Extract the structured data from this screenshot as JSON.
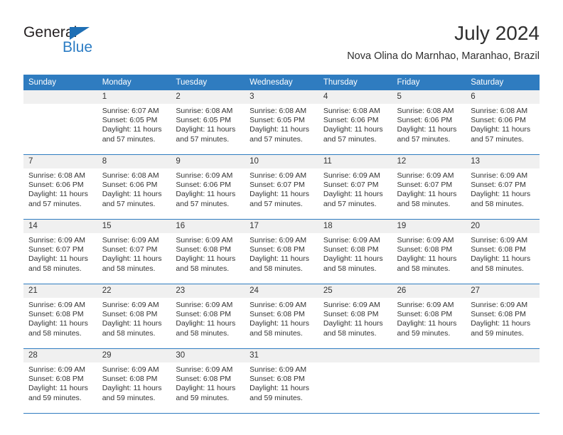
{
  "brand": {
    "name_part1": "General",
    "name_part2": "Blue",
    "accent_color": "#2b7cc4",
    "triangle_color": "#1f6fb5"
  },
  "header": {
    "title": "July 2024",
    "subtitle": "Nova Olina do Marnhao, Maranhao, Brazil"
  },
  "calendar": {
    "header_bg": "#2f7cc0",
    "daynum_bg": "#f0f0f0",
    "weekday_headers": [
      "Sunday",
      "Monday",
      "Tuesday",
      "Wednesday",
      "Thursday",
      "Friday",
      "Saturday"
    ],
    "weeks": [
      [
        {
          "day": "",
          "sunrise": "",
          "sunset": "",
          "daylight1": "",
          "daylight2": ""
        },
        {
          "day": "1",
          "sunrise": "Sunrise: 6:07 AM",
          "sunset": "Sunset: 6:05 PM",
          "daylight1": "Daylight: 11 hours",
          "daylight2": "and 57 minutes."
        },
        {
          "day": "2",
          "sunrise": "Sunrise: 6:08 AM",
          "sunset": "Sunset: 6:05 PM",
          "daylight1": "Daylight: 11 hours",
          "daylight2": "and 57 minutes."
        },
        {
          "day": "3",
          "sunrise": "Sunrise: 6:08 AM",
          "sunset": "Sunset: 6:05 PM",
          "daylight1": "Daylight: 11 hours",
          "daylight2": "and 57 minutes."
        },
        {
          "day": "4",
          "sunrise": "Sunrise: 6:08 AM",
          "sunset": "Sunset: 6:06 PM",
          "daylight1": "Daylight: 11 hours",
          "daylight2": "and 57 minutes."
        },
        {
          "day": "5",
          "sunrise": "Sunrise: 6:08 AM",
          "sunset": "Sunset: 6:06 PM",
          "daylight1": "Daylight: 11 hours",
          "daylight2": "and 57 minutes."
        },
        {
          "day": "6",
          "sunrise": "Sunrise: 6:08 AM",
          "sunset": "Sunset: 6:06 PM",
          "daylight1": "Daylight: 11 hours",
          "daylight2": "and 57 minutes."
        }
      ],
      [
        {
          "day": "7",
          "sunrise": "Sunrise: 6:08 AM",
          "sunset": "Sunset: 6:06 PM",
          "daylight1": "Daylight: 11 hours",
          "daylight2": "and 57 minutes."
        },
        {
          "day": "8",
          "sunrise": "Sunrise: 6:08 AM",
          "sunset": "Sunset: 6:06 PM",
          "daylight1": "Daylight: 11 hours",
          "daylight2": "and 57 minutes."
        },
        {
          "day": "9",
          "sunrise": "Sunrise: 6:09 AM",
          "sunset": "Sunset: 6:06 PM",
          "daylight1": "Daylight: 11 hours",
          "daylight2": "and 57 minutes."
        },
        {
          "day": "10",
          "sunrise": "Sunrise: 6:09 AM",
          "sunset": "Sunset: 6:07 PM",
          "daylight1": "Daylight: 11 hours",
          "daylight2": "and 57 minutes."
        },
        {
          "day": "11",
          "sunrise": "Sunrise: 6:09 AM",
          "sunset": "Sunset: 6:07 PM",
          "daylight1": "Daylight: 11 hours",
          "daylight2": "and 57 minutes."
        },
        {
          "day": "12",
          "sunrise": "Sunrise: 6:09 AM",
          "sunset": "Sunset: 6:07 PM",
          "daylight1": "Daylight: 11 hours",
          "daylight2": "and 58 minutes."
        },
        {
          "day": "13",
          "sunrise": "Sunrise: 6:09 AM",
          "sunset": "Sunset: 6:07 PM",
          "daylight1": "Daylight: 11 hours",
          "daylight2": "and 58 minutes."
        }
      ],
      [
        {
          "day": "14",
          "sunrise": "Sunrise: 6:09 AM",
          "sunset": "Sunset: 6:07 PM",
          "daylight1": "Daylight: 11 hours",
          "daylight2": "and 58 minutes."
        },
        {
          "day": "15",
          "sunrise": "Sunrise: 6:09 AM",
          "sunset": "Sunset: 6:07 PM",
          "daylight1": "Daylight: 11 hours",
          "daylight2": "and 58 minutes."
        },
        {
          "day": "16",
          "sunrise": "Sunrise: 6:09 AM",
          "sunset": "Sunset: 6:08 PM",
          "daylight1": "Daylight: 11 hours",
          "daylight2": "and 58 minutes."
        },
        {
          "day": "17",
          "sunrise": "Sunrise: 6:09 AM",
          "sunset": "Sunset: 6:08 PM",
          "daylight1": "Daylight: 11 hours",
          "daylight2": "and 58 minutes."
        },
        {
          "day": "18",
          "sunrise": "Sunrise: 6:09 AM",
          "sunset": "Sunset: 6:08 PM",
          "daylight1": "Daylight: 11 hours",
          "daylight2": "and 58 minutes."
        },
        {
          "day": "19",
          "sunrise": "Sunrise: 6:09 AM",
          "sunset": "Sunset: 6:08 PM",
          "daylight1": "Daylight: 11 hours",
          "daylight2": "and 58 minutes."
        },
        {
          "day": "20",
          "sunrise": "Sunrise: 6:09 AM",
          "sunset": "Sunset: 6:08 PM",
          "daylight1": "Daylight: 11 hours",
          "daylight2": "and 58 minutes."
        }
      ],
      [
        {
          "day": "21",
          "sunrise": "Sunrise: 6:09 AM",
          "sunset": "Sunset: 6:08 PM",
          "daylight1": "Daylight: 11 hours",
          "daylight2": "and 58 minutes."
        },
        {
          "day": "22",
          "sunrise": "Sunrise: 6:09 AM",
          "sunset": "Sunset: 6:08 PM",
          "daylight1": "Daylight: 11 hours",
          "daylight2": "and 58 minutes."
        },
        {
          "day": "23",
          "sunrise": "Sunrise: 6:09 AM",
          "sunset": "Sunset: 6:08 PM",
          "daylight1": "Daylight: 11 hours",
          "daylight2": "and 58 minutes."
        },
        {
          "day": "24",
          "sunrise": "Sunrise: 6:09 AM",
          "sunset": "Sunset: 6:08 PM",
          "daylight1": "Daylight: 11 hours",
          "daylight2": "and 58 minutes."
        },
        {
          "day": "25",
          "sunrise": "Sunrise: 6:09 AM",
          "sunset": "Sunset: 6:08 PM",
          "daylight1": "Daylight: 11 hours",
          "daylight2": "and 58 minutes."
        },
        {
          "day": "26",
          "sunrise": "Sunrise: 6:09 AM",
          "sunset": "Sunset: 6:08 PM",
          "daylight1": "Daylight: 11 hours",
          "daylight2": "and 59 minutes."
        },
        {
          "day": "27",
          "sunrise": "Sunrise: 6:09 AM",
          "sunset": "Sunset: 6:08 PM",
          "daylight1": "Daylight: 11 hours",
          "daylight2": "and 59 minutes."
        }
      ],
      [
        {
          "day": "28",
          "sunrise": "Sunrise: 6:09 AM",
          "sunset": "Sunset: 6:08 PM",
          "daylight1": "Daylight: 11 hours",
          "daylight2": "and 59 minutes."
        },
        {
          "day": "29",
          "sunrise": "Sunrise: 6:09 AM",
          "sunset": "Sunset: 6:08 PM",
          "daylight1": "Daylight: 11 hours",
          "daylight2": "and 59 minutes."
        },
        {
          "day": "30",
          "sunrise": "Sunrise: 6:09 AM",
          "sunset": "Sunset: 6:08 PM",
          "daylight1": "Daylight: 11 hours",
          "daylight2": "and 59 minutes."
        },
        {
          "day": "31",
          "sunrise": "Sunrise: 6:09 AM",
          "sunset": "Sunset: 6:08 PM",
          "daylight1": "Daylight: 11 hours",
          "daylight2": "and 59 minutes."
        },
        {
          "day": "",
          "sunrise": "",
          "sunset": "",
          "daylight1": "",
          "daylight2": ""
        },
        {
          "day": "",
          "sunrise": "",
          "sunset": "",
          "daylight1": "",
          "daylight2": ""
        },
        {
          "day": "",
          "sunrise": "",
          "sunset": "",
          "daylight1": "",
          "daylight2": ""
        }
      ]
    ]
  }
}
